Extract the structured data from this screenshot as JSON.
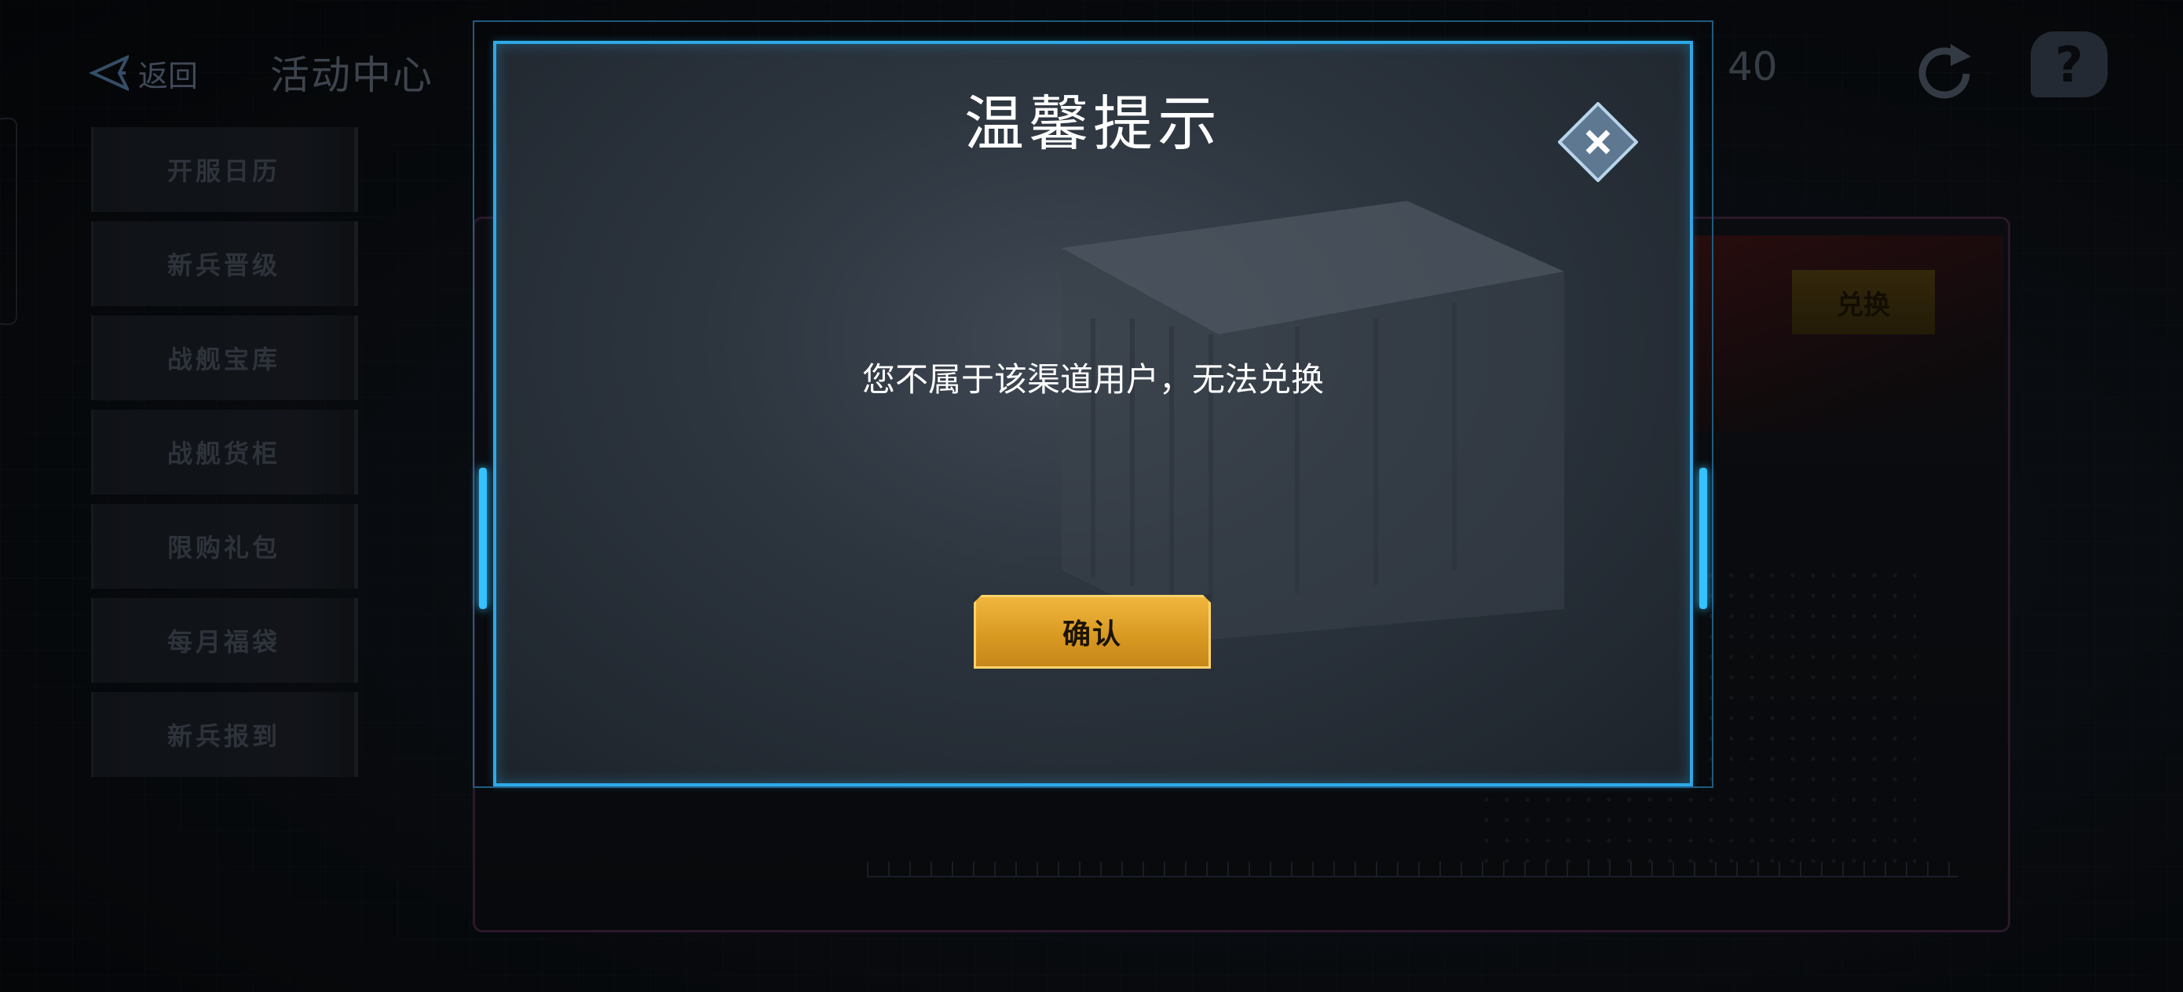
{
  "header": {
    "back_label": "返回",
    "title": "活动中心",
    "currency_value": "40"
  },
  "sidebar": {
    "items": [
      {
        "label": "开服日历"
      },
      {
        "label": "新兵晋级"
      },
      {
        "label": "战舰宝库"
      },
      {
        "label": "战舰货柜"
      },
      {
        "label": "限购礼包"
      },
      {
        "label": "每月福袋"
      },
      {
        "label": "新兵报到"
      }
    ]
  },
  "panel": {
    "exchange_label": "兑换"
  },
  "dialog": {
    "title": "温馨提示",
    "message": "您不属于该渠道用户，无法兑换",
    "confirm_label": "确认",
    "close_icon": "close-x-diamond"
  },
  "colors": {
    "dialog_border": "#2ea8e6",
    "confirm_button": "#e0a22c",
    "accent_magenta": "#4a2a48"
  }
}
